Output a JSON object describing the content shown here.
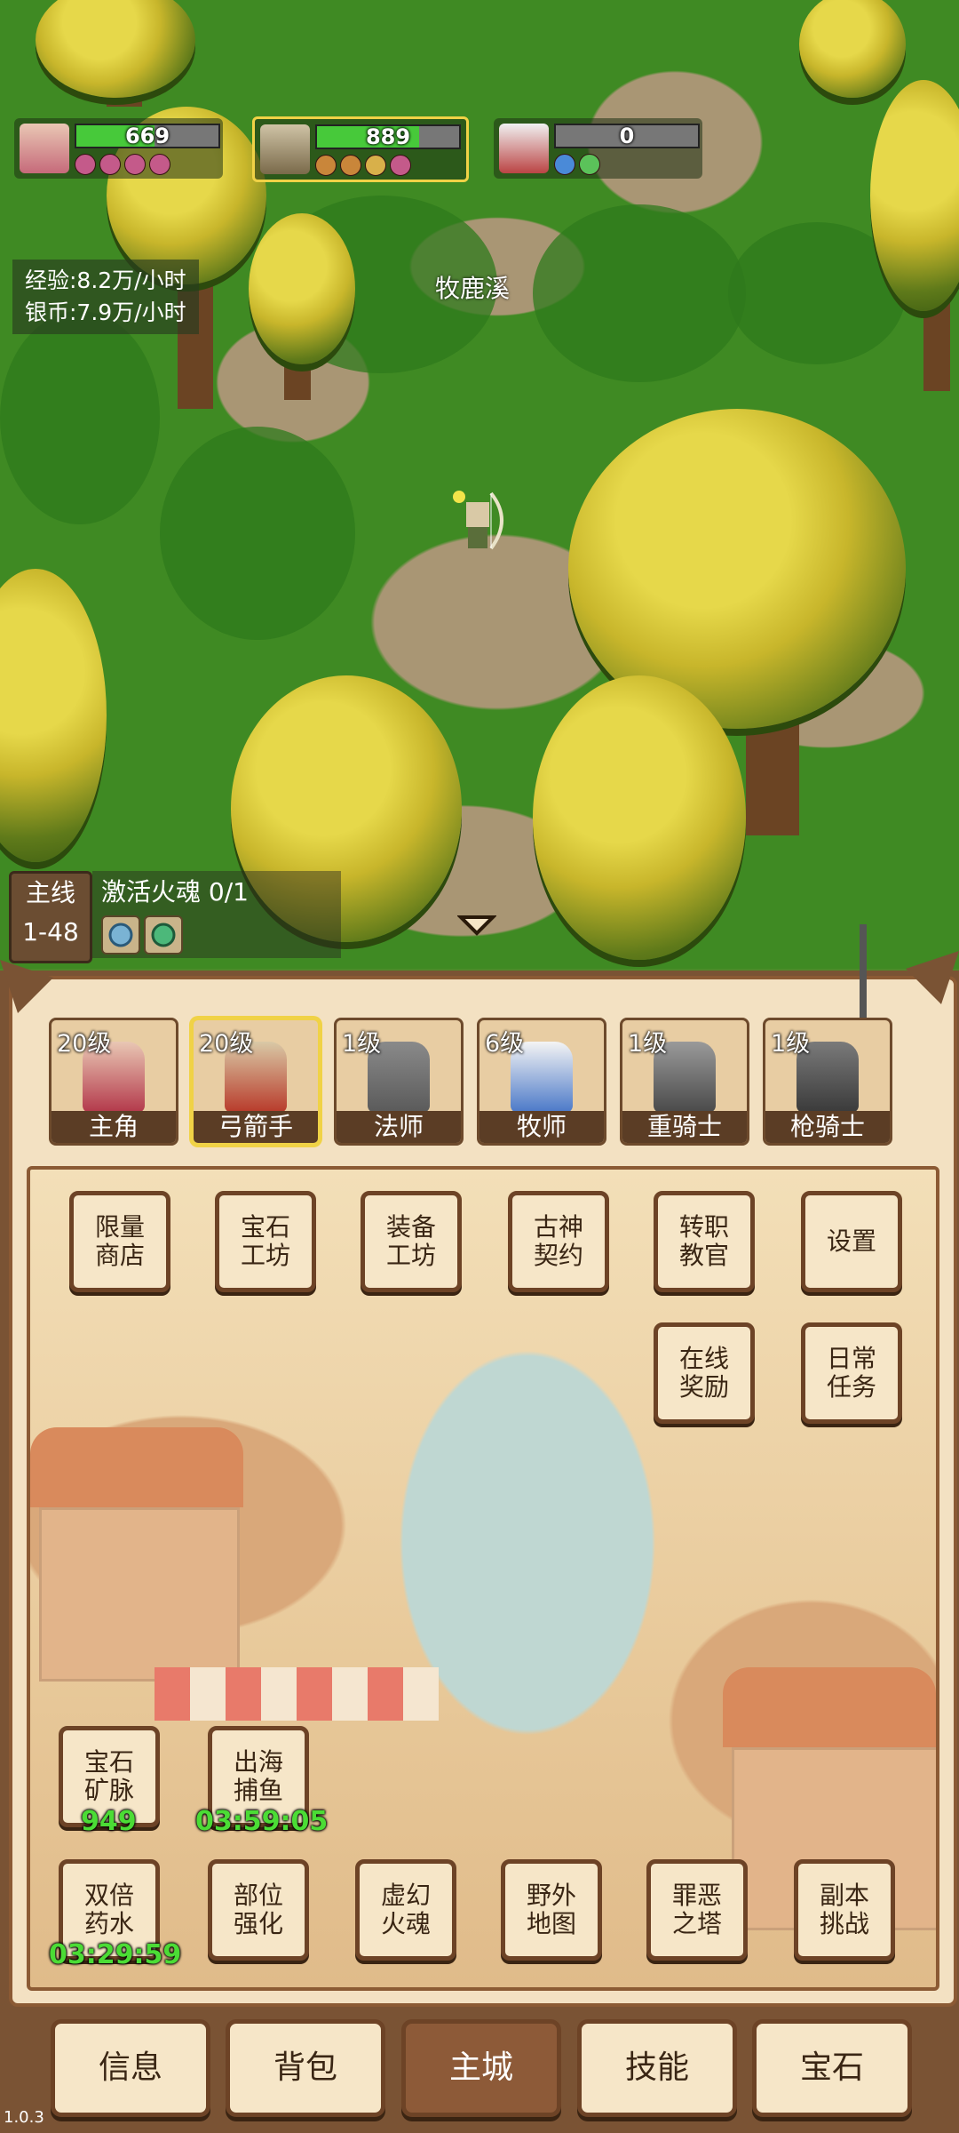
{
  "heroes": [
    {
      "hp": "669",
      "hp_fill": 0.55,
      "selected": false
    },
    {
      "hp": "889",
      "hp_fill": 0.72,
      "selected": true
    },
    {
      "hp": "0",
      "hp_fill": 0.0,
      "selected": false
    }
  ],
  "rates": {
    "exp": "经验:8.2万/小时",
    "silver": "银币:7.9万/小时"
  },
  "zone_name": "牧鹿溪",
  "quest": {
    "tag_line1": "主线",
    "tag_line2": "1-48",
    "text": "激活火魂 0/1"
  },
  "roles": [
    {
      "level": "20级",
      "name": "主角",
      "selected": false
    },
    {
      "level": "20级",
      "name": "弓箭手",
      "selected": true
    },
    {
      "level": "1级",
      "name": "法师",
      "selected": false
    },
    {
      "level": "6级",
      "name": "牧师",
      "selected": false
    },
    {
      "level": "1级",
      "name": "重骑士",
      "selected": false
    },
    {
      "level": "1级",
      "name": "枪骑士",
      "selected": false
    }
  ],
  "features_top": [
    "限量\n商店",
    "宝石\n工坊",
    "装备\n工坊",
    "古神\n契约",
    "转职\n教官",
    "设置"
  ],
  "features_mid": [
    "在线\n奖励",
    "日常\n任务"
  ],
  "features_low": [
    {
      "label": "宝石\n矿脉",
      "timer": "949"
    },
    {
      "label": "出海\n捕鱼",
      "timer": "03:59:05"
    }
  ],
  "features_bottom": [
    {
      "label": "双倍\n药水",
      "timer": "03:29:59"
    },
    {
      "label": "部位\n强化"
    },
    {
      "label": "虚幻\n火魂"
    },
    {
      "label": "野外\n地图"
    },
    {
      "label": "罪恶\n之塔"
    },
    {
      "label": "副本\n挑战"
    }
  ],
  "nav": [
    "信息",
    "背包",
    "主城",
    "技能",
    "宝石"
  ],
  "nav_active": 2,
  "version": "1.0.3",
  "colors": {
    "hp_green": "#47c93a",
    "timer_green": "#4bdc35",
    "frame_brown": "#6d4326",
    "highlight": "#f0d246"
  }
}
